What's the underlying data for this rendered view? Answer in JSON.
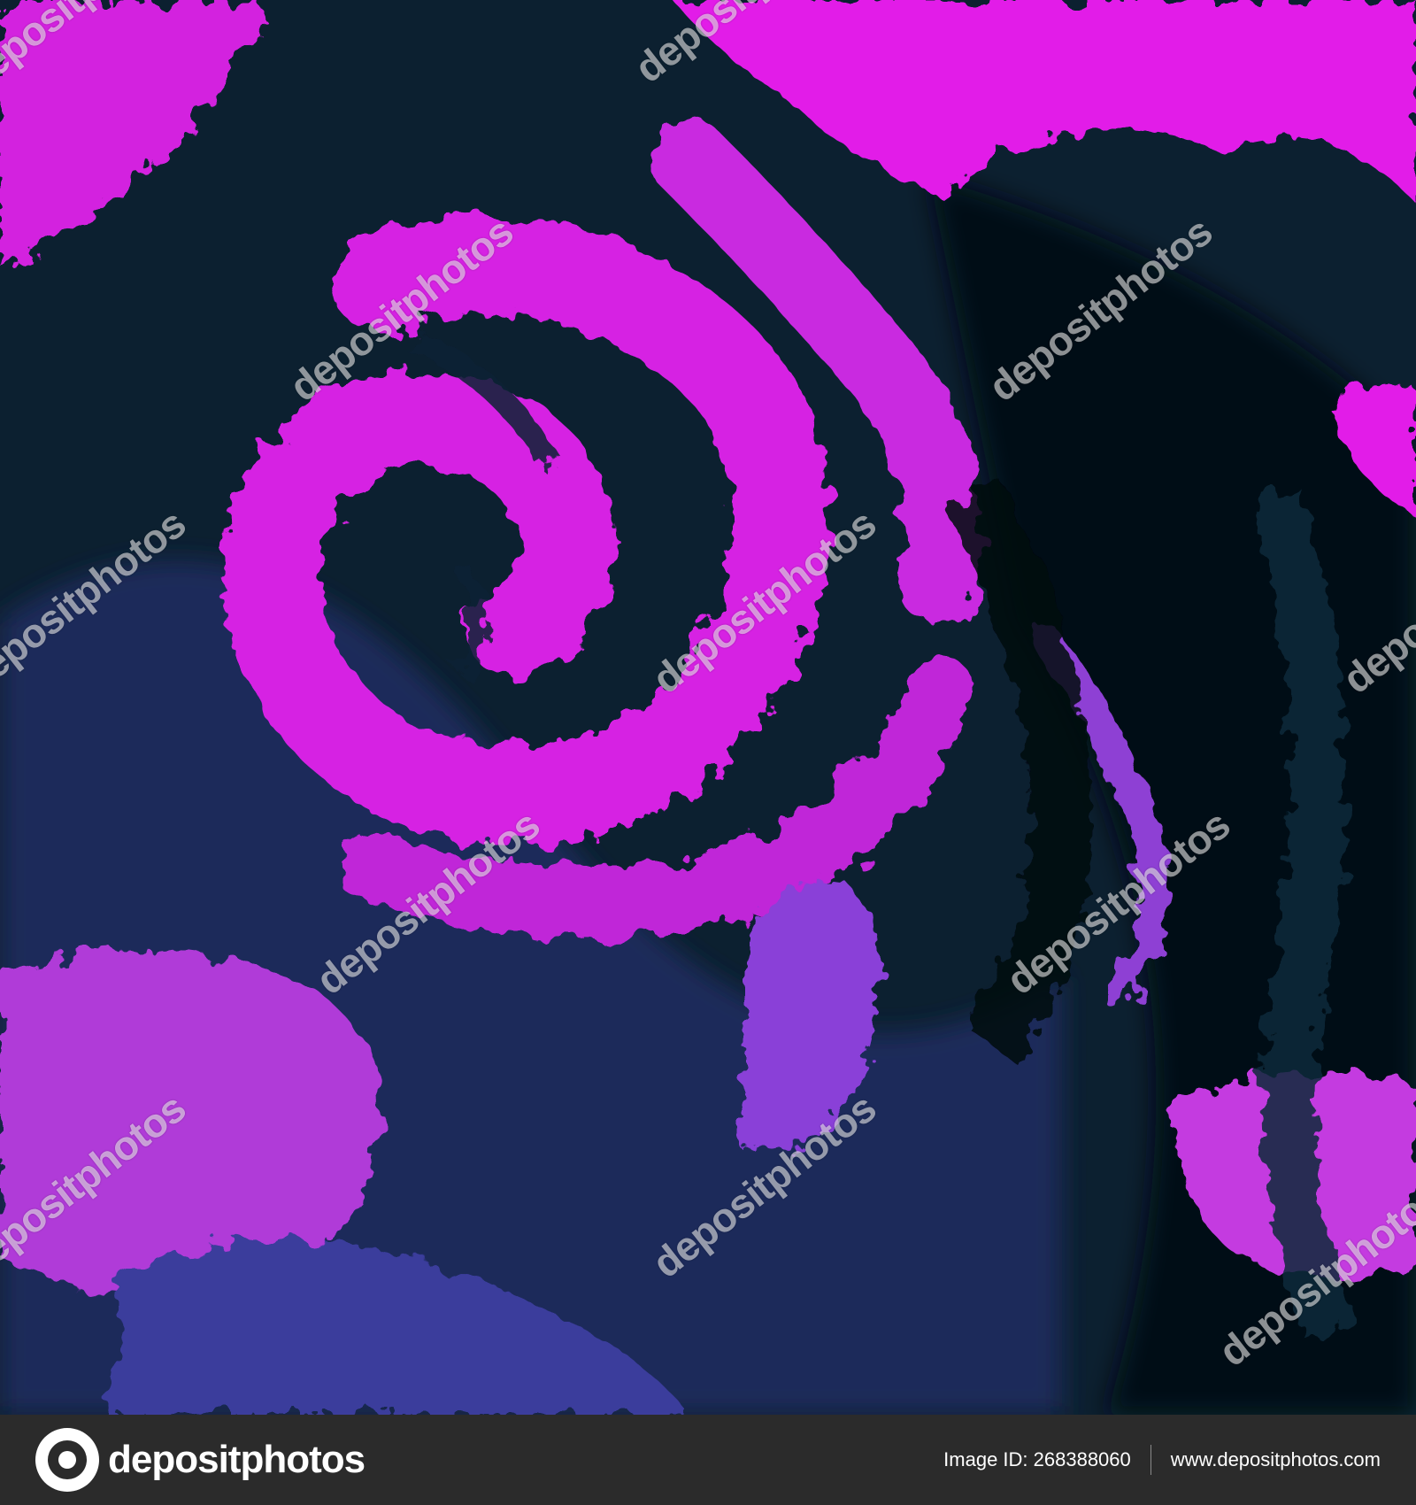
{
  "watermark": {
    "text": "depositphotos"
  },
  "footer": {
    "brand": "depositphotos",
    "image_id": "Image ID: 268388060",
    "site": "www.depositphotos.com"
  },
  "colors": {
    "magenta": "#e020e8",
    "violet": "#7f3fd6",
    "navy": "#1e2a5c",
    "deep_teal": "#0b2233",
    "footer_bg": "#2b2b2b"
  },
  "icons": {
    "logo": "depositphotos-logo-icon"
  }
}
